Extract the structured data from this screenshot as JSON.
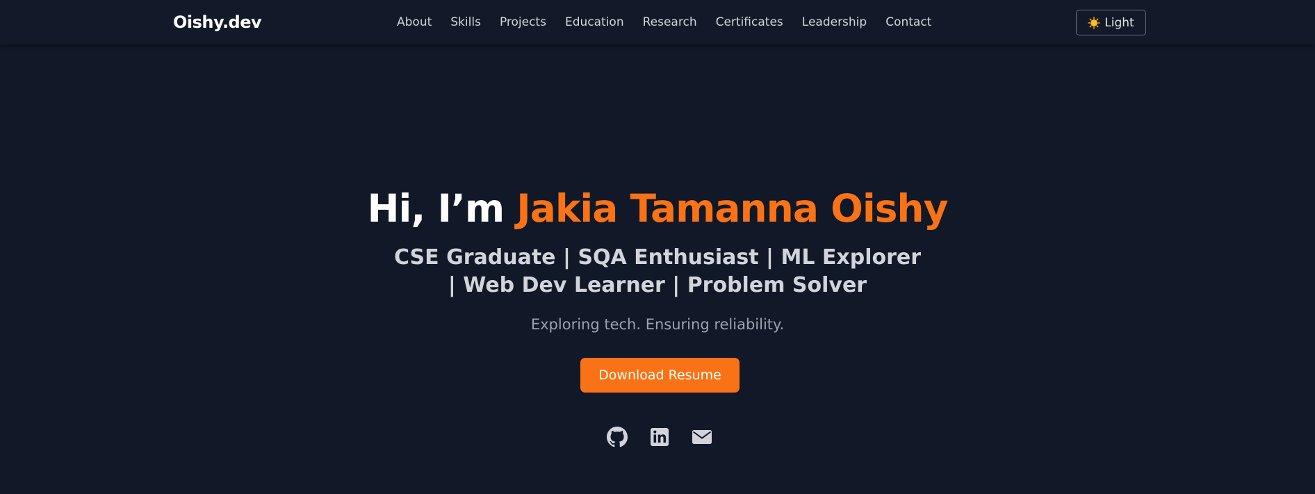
{
  "brand": "Oishy.dev",
  "nav": {
    "items": [
      "About",
      "Skills",
      "Projects",
      "Education",
      "Research",
      "Certificates",
      "Leadership",
      "Contact"
    ]
  },
  "theme_toggle": {
    "icon": "sun-icon",
    "label": "Light"
  },
  "hero": {
    "greeting": "Hi, I’m",
    "name": "Jakia Tamanna Oishy",
    "subtitle": "CSE Graduate | SQA Enthusiast | ML Explorer | Web Dev Learner | Problem Solver",
    "tagline": "Exploring tech. Ensuring reliability.",
    "cta_label": "Download Resume"
  },
  "socials": [
    {
      "icon": "github-icon"
    },
    {
      "icon": "linkedin-icon"
    },
    {
      "icon": "envelope-icon"
    }
  ],
  "colors": {
    "background": "#111827",
    "navbar": "#121a29",
    "accent": "#f97316",
    "text_primary": "#ffffff",
    "text_secondary": "#d1d5db",
    "text_muted": "#9ca3af"
  }
}
